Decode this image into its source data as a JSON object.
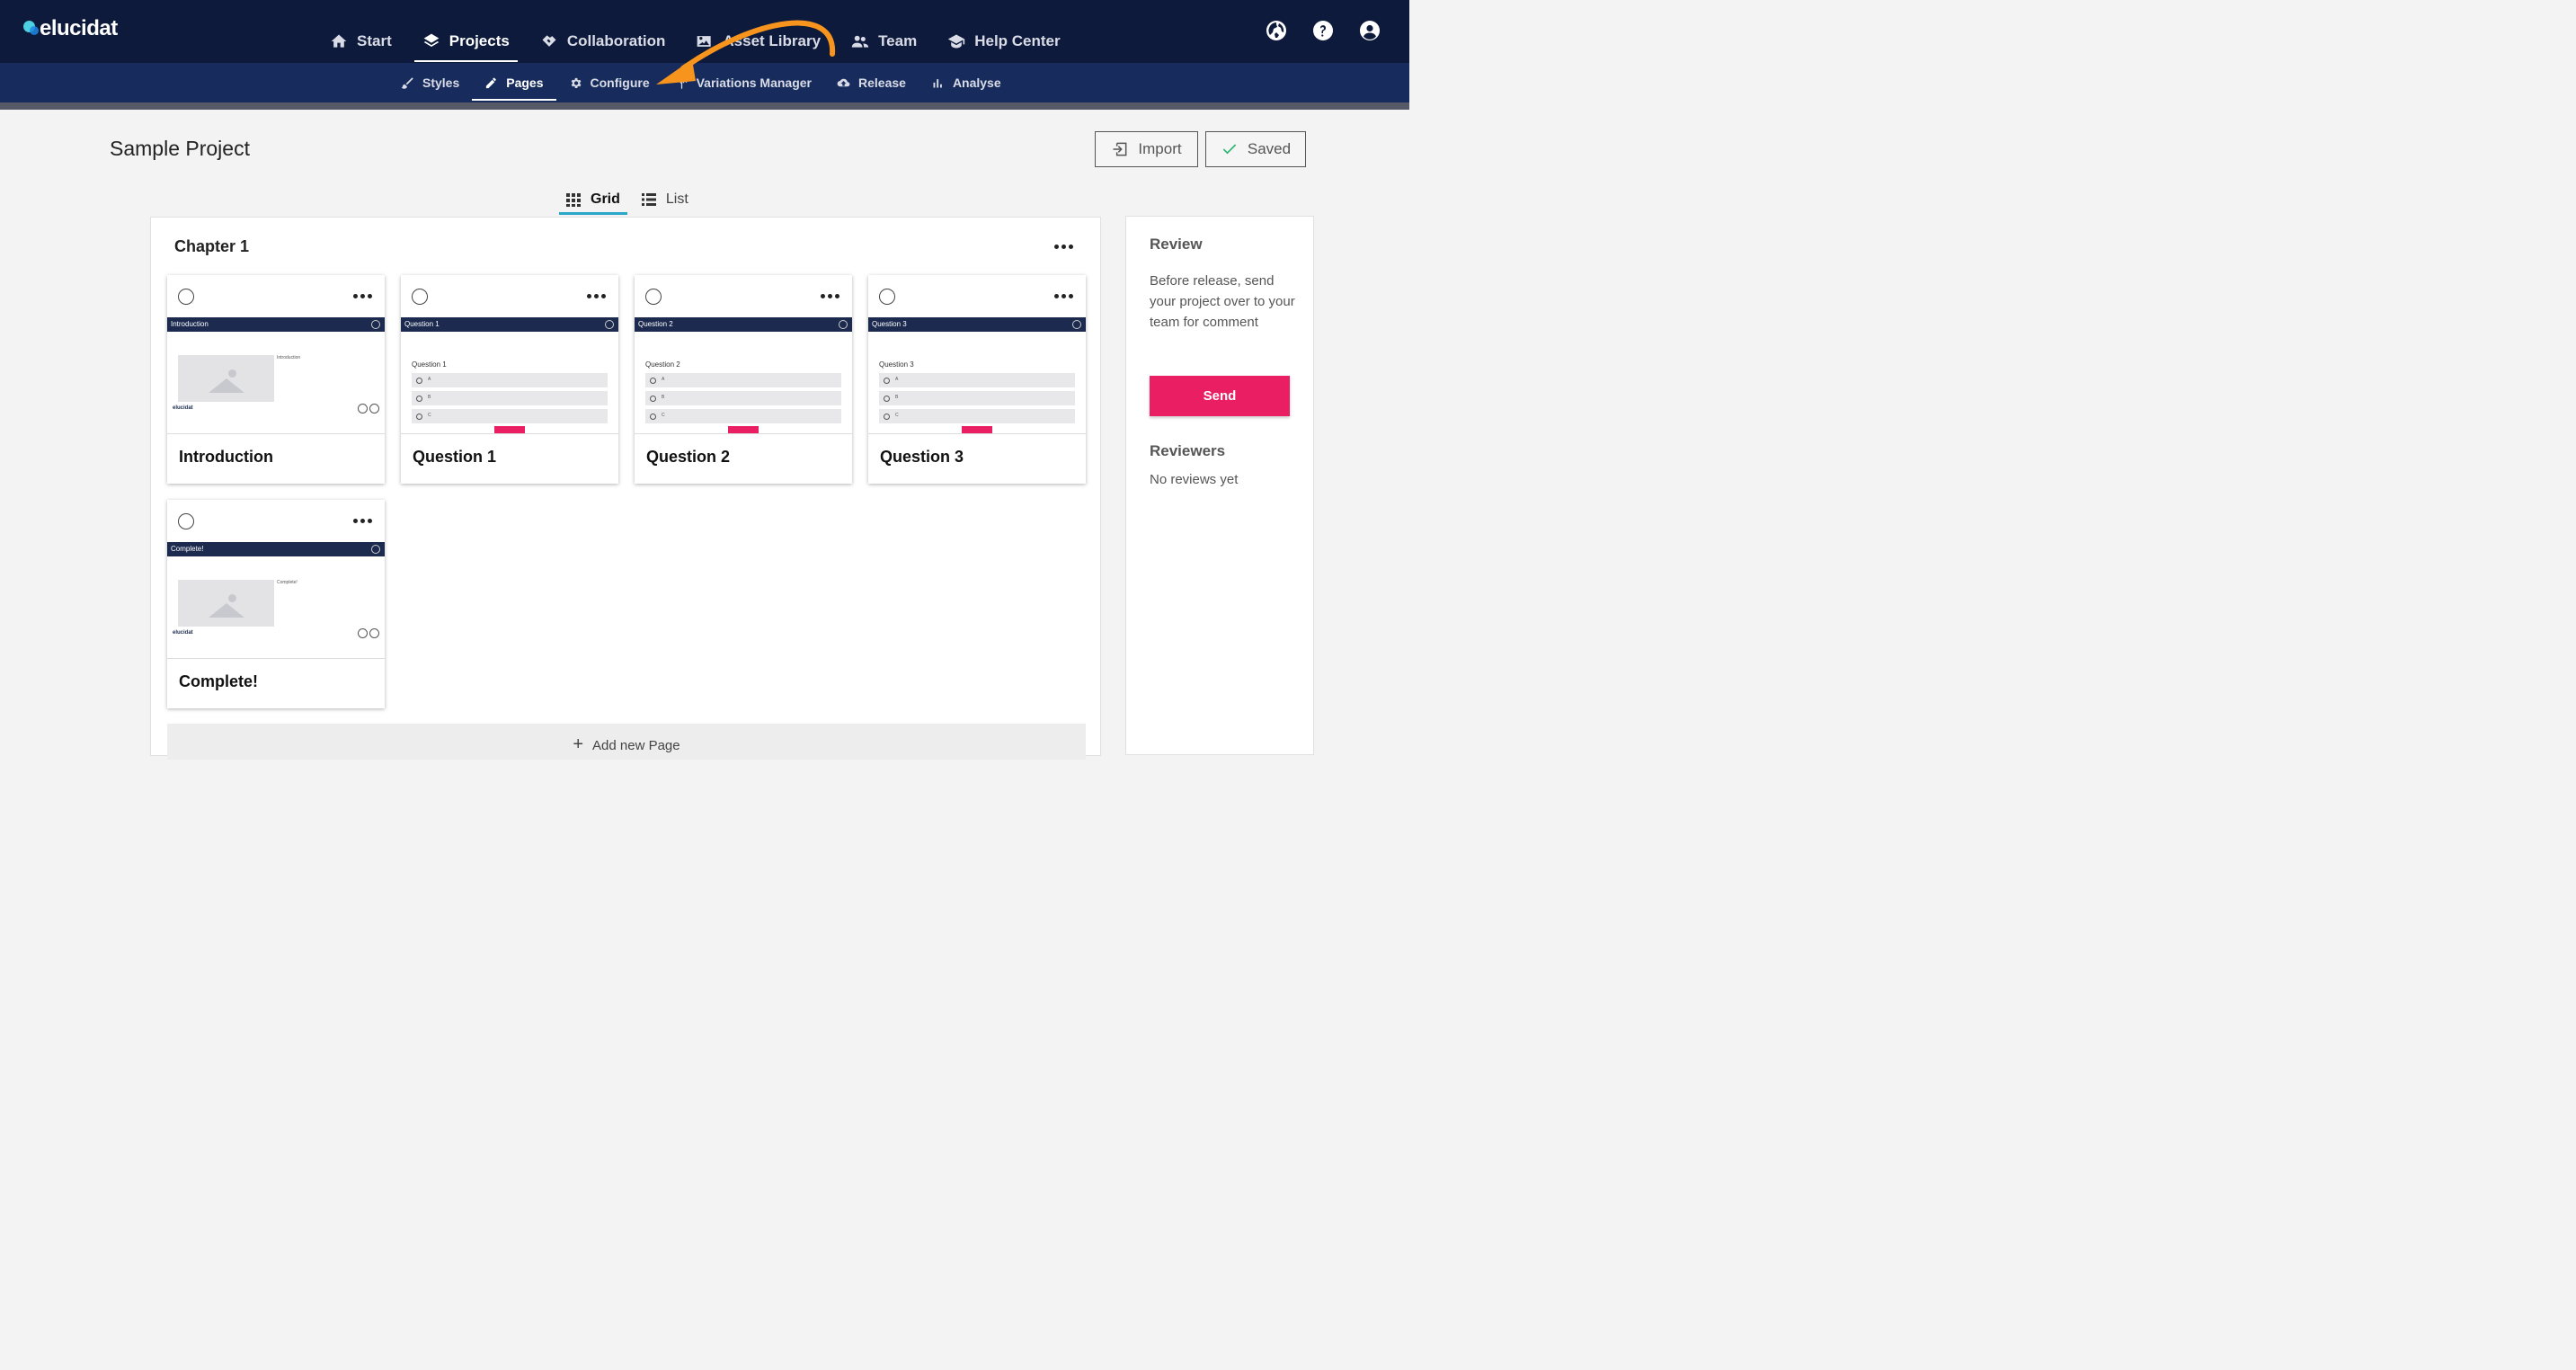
{
  "app": {
    "logo_text": "elucidat"
  },
  "main_nav": [
    {
      "label": "Start",
      "icon": "home-icon"
    },
    {
      "label": "Projects",
      "icon": "layers-icon",
      "active": true
    },
    {
      "label": "Collaboration",
      "icon": "handshake-icon"
    },
    {
      "label": "Asset Library",
      "icon": "image-icon"
    },
    {
      "label": "Team",
      "icon": "people-icon"
    },
    {
      "label": "Help Center",
      "icon": "graduation-cap-icon"
    }
  ],
  "sub_nav": [
    {
      "label": "Styles",
      "icon": "brush-icon"
    },
    {
      "label": "Pages",
      "icon": "pencil-icon",
      "active": true
    },
    {
      "label": "Configure",
      "icon": "gear-icon"
    },
    {
      "label": "Variations Manager",
      "icon": "split-icon"
    },
    {
      "label": "Release",
      "icon": "cloud-upload-icon"
    },
    {
      "label": "Analyse",
      "icon": "bar-chart-icon"
    }
  ],
  "page": {
    "title": "Sample Project",
    "import_label": "Import",
    "saved_label": "Saved"
  },
  "view_tabs": {
    "grid": "Grid",
    "list": "List",
    "active": "Grid"
  },
  "chapter": {
    "title": "Chapter 1",
    "pages": [
      {
        "name": "Introduction",
        "thumb_title": "Introduction",
        "type": "content",
        "caption": "Introduction",
        "brand": "elucidat"
      },
      {
        "name": "Question 1",
        "thumb_title": "Question 1",
        "type": "question",
        "question": "Question 1",
        "options": [
          "A",
          "B",
          "C"
        ]
      },
      {
        "name": "Question 2",
        "thumb_title": "Question 2",
        "type": "question",
        "question": "Question 2",
        "options": [
          "A",
          "B",
          "C"
        ]
      },
      {
        "name": "Question 3",
        "thumb_title": "Question 3",
        "type": "question",
        "question": "Question 3",
        "options": [
          "A",
          "B",
          "C"
        ]
      },
      {
        "name": "Complete!",
        "thumb_title": "Complete!",
        "type": "content",
        "caption": "Complete!",
        "brand": "elucidat"
      }
    ],
    "add_page_label": "Add new Page"
  },
  "review": {
    "title": "Review",
    "description": "Before release, send your project over to your team for comment",
    "send_label": "Send",
    "reviewers_title": "Reviewers",
    "reviewers_empty": "No reviews yet"
  },
  "colors": {
    "topbar": "#0e1a3b",
    "subbar": "#172c5c",
    "accent_pink": "#e91e63",
    "tab_underline": "#2aa6c8",
    "annotation_arrow": "#f7941d"
  }
}
